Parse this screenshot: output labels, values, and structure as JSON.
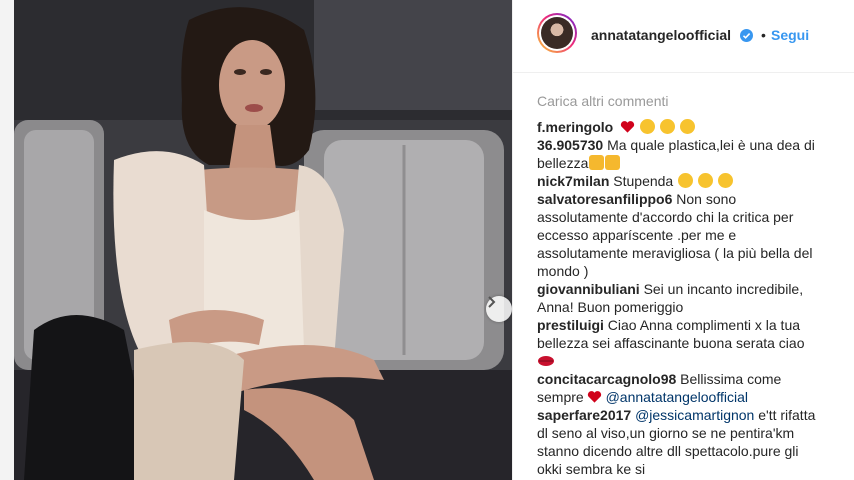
{
  "header": {
    "username": "annatatangeloofficial",
    "separator": "•",
    "follow_label": "Segui"
  },
  "comments_section": {
    "load_more_label": "Carica altri commenti",
    "comments": [
      {
        "user": "f.meringolo",
        "text": "",
        "emojis": [
          "heart",
          "heart-eyes",
          "heart-eyes",
          "heart-eyes"
        ]
      },
      {
        "user": "36.905730",
        "text": "Ma quale plastica,lei è una dea di bellezza",
        "emojis": [
          "thumbs-up",
          "thumbs-up"
        ]
      },
      {
        "user": "nick7milan",
        "text": "Stupenda",
        "emojis": [
          "kiss",
          "kiss",
          "kiss"
        ]
      },
      {
        "user": "salvatoresanfilippo6",
        "text": "Non sono assolutamente d'accordo chi la critica per eccesso apparíscente .per me e assolutamente meravigliosa ( la più bella del mondo )"
      },
      {
        "user": "giovannibuliani",
        "text": "Sei un incanto incredibile, Anna! Buon pomeriggio"
      },
      {
        "user": "prestiluigi",
        "text": "Ciao Anna complimenti x la tua bellezza sei affascinante buona serata ciao",
        "emojis_after": [
          "lips"
        ]
      },
      {
        "user": "concitacarcagnolo98",
        "text": "Bellissima come sempre",
        "emojis_inline": [
          "heart"
        ],
        "mention": "@annatatangeloofficial"
      },
      {
        "user": "saperfare2017",
        "mention": "@jessicamartignon",
        "text": "e'tt rifatta dl seno al viso,un giorno se ne pentira'km stanno dicendo altre dll spettacolo.pure gli okki sembra ke si"
      }
    ]
  },
  "colors": {
    "link_blue": "#3897f0",
    "mention_blue": "#003569",
    "muted_gray": "#999999",
    "text": "#262626"
  },
  "icons": {
    "verified": "verified-badge-icon",
    "next": "chevron-right-icon"
  }
}
